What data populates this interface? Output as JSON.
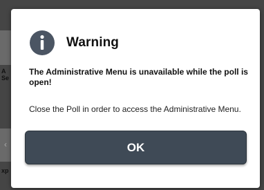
{
  "background": {
    "text_1": "A",
    "text_2": "Se",
    "text_3": "xp",
    "chevron": "‹"
  },
  "dialog": {
    "title": "Warning",
    "icon": "info-icon",
    "message_primary": "The Administrative Menu is unavailable while the poll is open!",
    "message_secondary": "Close the Poll in order to access the Administrative Menu.",
    "ok_label": "OK"
  },
  "colors": {
    "icon_bg": "#4b5563",
    "button_bg": "#3f4a56",
    "overlay": "#454545"
  }
}
